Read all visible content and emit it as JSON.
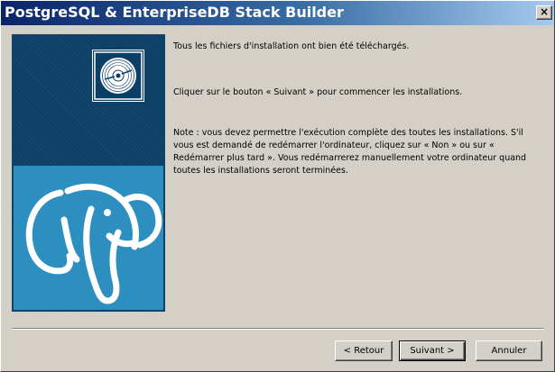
{
  "window": {
    "title": "PostgreSQL & EnterpriseDB Stack Builder",
    "close_label": "×"
  },
  "side_panel": {
    "icons": [
      "disc-icon",
      "postgresql-elephant-icon"
    ]
  },
  "content": {
    "message_downloaded": "Tous les fichiers d'installation ont bien été téléchargés.",
    "message_next": "Cliquer sur le bouton « Suivant » pour commencer les installations.",
    "message_note": "Note : vous devez permettre l'exécution complète des toutes les installations. S'il vous est demandé de redémarrer l'ordinateur, cliquez sur « Non » ou sur « Redémarrer plus tard ». Vous redémarrerez manuellement votre ordinateur quand toutes les installations seront terminées."
  },
  "buttons": {
    "back": "< Retour",
    "next": "Suivant >",
    "cancel": "Annuler"
  },
  "colors": {
    "title_gradient_start": "#0a246a",
    "title_gradient_end": "#a6caf0",
    "dialog_background": "#d4d0c8",
    "side_panel_background": "#0b3f66",
    "logo_background": "#2d8fbf"
  }
}
